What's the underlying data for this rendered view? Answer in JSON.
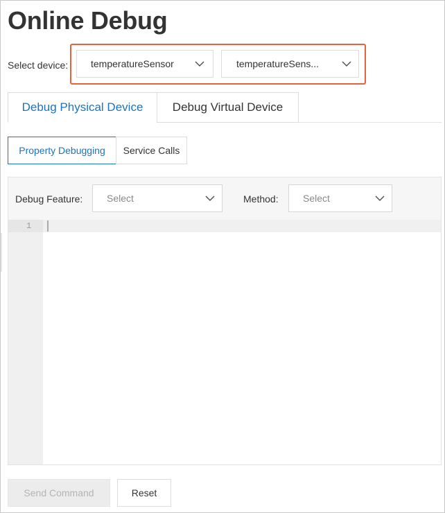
{
  "page": {
    "title": "Online Debug"
  },
  "device_selector": {
    "label": "Select device:",
    "product_value": "temperatureSensor",
    "device_value": "temperatureSens..."
  },
  "tabs": [
    {
      "label": "Debug Physical Device",
      "active": true
    },
    {
      "label": "Debug Virtual Device",
      "active": false
    }
  ],
  "subtabs": [
    {
      "label": "Property Debugging",
      "active": true
    },
    {
      "label": "Service Calls",
      "active": false
    }
  ],
  "debug_panel": {
    "feature_label": "Debug Feature:",
    "feature_value": "Select",
    "method_label": "Method:",
    "method_value": "Select"
  },
  "editor": {
    "line_numbers": [
      "1"
    ]
  },
  "actions": {
    "send_label": "Send Command",
    "reset_label": "Reset"
  },
  "colors": {
    "accent": "#1874c4",
    "highlight": "#e8613c",
    "disabled_bg": "#ececec"
  },
  "icons": [
    "chevron-down-icon"
  ]
}
